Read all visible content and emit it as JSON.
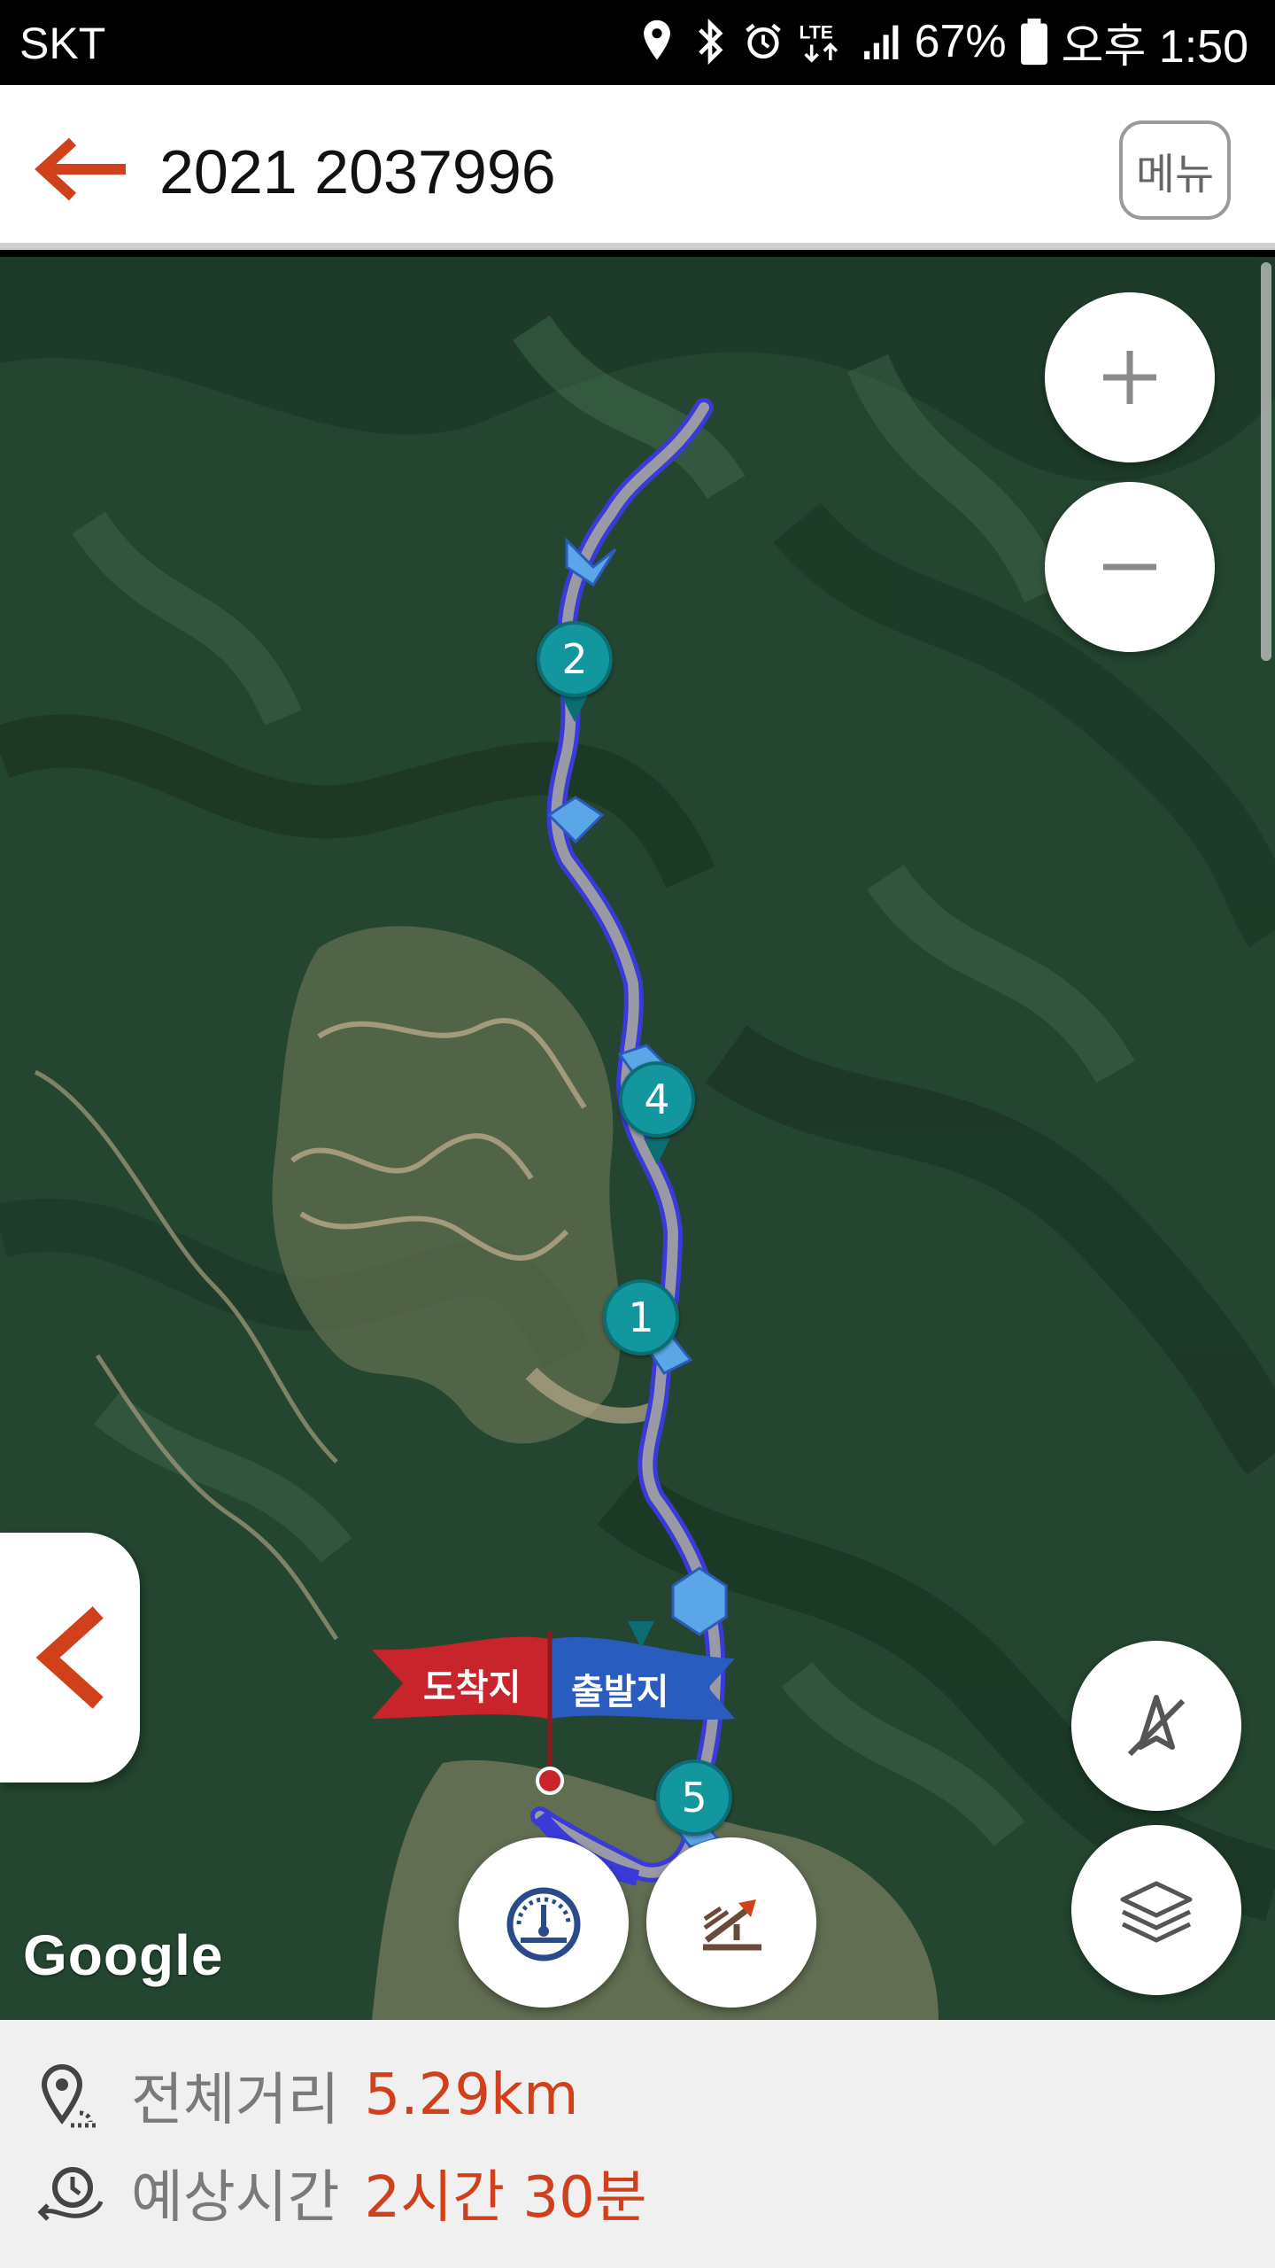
{
  "status_bar": {
    "carrier": "SKT",
    "network": "LTE",
    "battery": "67%",
    "time": "오후 1:50",
    "icons": [
      "location-icon",
      "bluetooth-icon",
      "alarm-icon",
      "lte-icon",
      "signal-icon",
      "battery-icon"
    ]
  },
  "app_bar": {
    "back_icon": "arrow-left-icon",
    "title": "2021 2037996",
    "menu_label": "메뉴"
  },
  "map": {
    "provider_logo": "Google",
    "route_color": "#3a3ad8",
    "flags": {
      "end_label": "도착지",
      "start_label": "출발지"
    },
    "waypoints": [
      {
        "label": "2"
      },
      {
        "label": "4"
      },
      {
        "label": "1"
      },
      {
        "label": "5"
      }
    ],
    "controls": {
      "zoom_in": "plus-icon",
      "zoom_out": "minus-icon",
      "compass": "compass-off-icon",
      "layers": "layers-icon",
      "speedometer": "speedometer-icon",
      "elevation": "elevation-icon",
      "side_panel": "chevron-left-icon"
    }
  },
  "summary": {
    "distance_label": "전체거리",
    "distance_value": "5.29km",
    "time_label": "예상시간",
    "time_value": "2시간 30분"
  },
  "colors": {
    "accent": "#d0401a",
    "marker": "#13979f",
    "end_flag": "#c8242c",
    "start_flag": "#2a5bbf"
  }
}
